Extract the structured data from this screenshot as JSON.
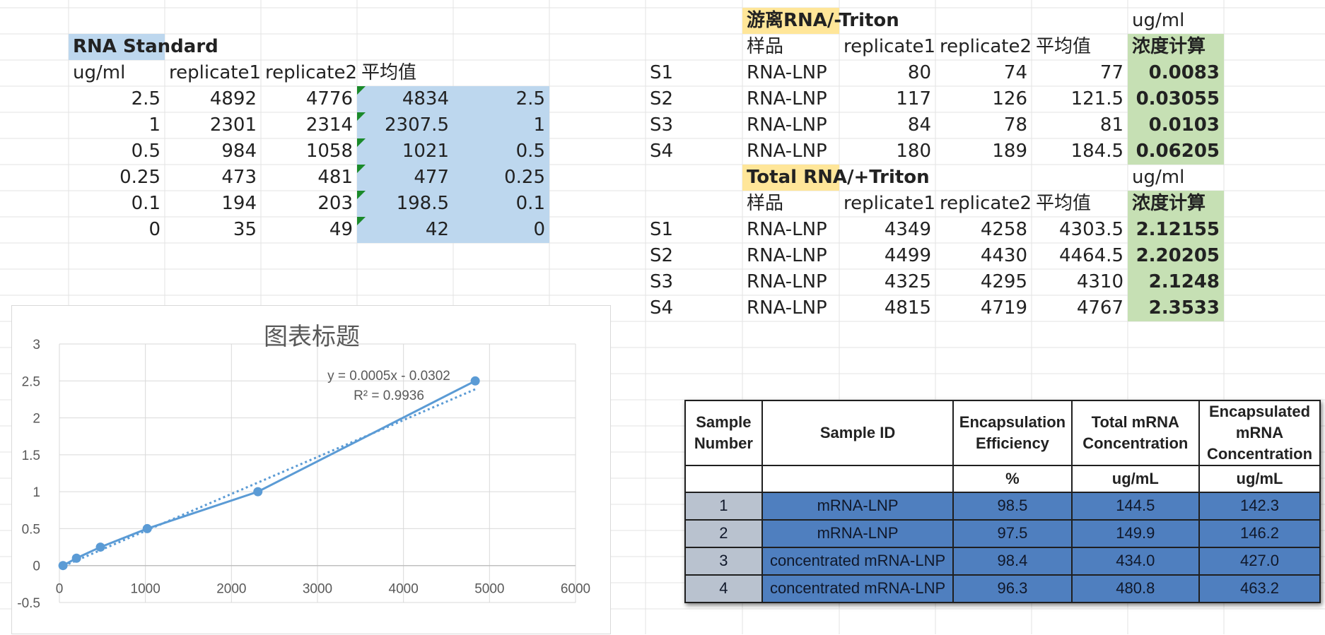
{
  "sheet": {
    "standard": {
      "title": "RNA Standard",
      "headers": [
        "ug/ml",
        "replicate1",
        "replicate2",
        "平均值"
      ],
      "rows": [
        [
          "2.5",
          "4892",
          "4776",
          "4834",
          "2.5"
        ],
        [
          "1",
          "2301",
          "2314",
          "2307.5",
          "1"
        ],
        [
          "0.5",
          "984",
          "1058",
          "1021",
          "0.5"
        ],
        [
          "0.25",
          "473",
          "481",
          "477",
          "0.25"
        ],
        [
          "0.1",
          "194",
          "203",
          "198.5",
          "0.1"
        ],
        [
          "0",
          "35",
          "49",
          "42",
          "0"
        ]
      ]
    },
    "free_rna": {
      "title": "游离RNA/-Triton",
      "unit": "ug/ml",
      "headers": [
        "样品",
        "replicate1",
        "replicate2",
        "平均值",
        "浓度计算"
      ],
      "rows": [
        [
          "S1",
          "RNA-LNP",
          "80",
          "74",
          "77",
          "0.0083"
        ],
        [
          "S2",
          "RNA-LNP",
          "117",
          "126",
          "121.5",
          "0.03055"
        ],
        [
          "S3",
          "RNA-LNP",
          "84",
          "78",
          "81",
          "0.0103"
        ],
        [
          "S4",
          "RNA-LNP",
          "180",
          "189",
          "184.5",
          "0.06205"
        ]
      ]
    },
    "total_rna": {
      "title": "Total RNA/+Triton",
      "unit": "ug/ml",
      "headers": [
        "样品",
        "replicate1",
        "replicate2",
        "平均值",
        "浓度计算"
      ],
      "rows": [
        [
          "S1",
          "RNA-LNP",
          "4349",
          "4258",
          "4303.5",
          "2.12155"
        ],
        [
          "S2",
          "RNA-LNP",
          "4499",
          "4430",
          "4464.5",
          "2.20205"
        ],
        [
          "S3",
          "RNA-LNP",
          "4325",
          "4295",
          "4310",
          "2.1248"
        ],
        [
          "S4",
          "RNA-LNP",
          "4815",
          "4719",
          "4767",
          "2.3533"
        ]
      ]
    }
  },
  "chart_data": {
    "type": "scatter",
    "title": "图表标题",
    "x": [
      4834,
      2307.5,
      1021,
      477,
      198.5,
      42
    ],
    "y": [
      2.5,
      1,
      0.5,
      0.25,
      0.1,
      0
    ],
    "series_color": "#5b9bd5",
    "trendline": {
      "label": "y = 0.0005x - 0.0302",
      "r2": "R² = 0.9936",
      "slope": 0.0005,
      "intercept": -0.0302
    },
    "xlim": [
      0,
      6000
    ],
    "ylim": [
      -0.5,
      3
    ],
    "x_ticks": [
      "0",
      "1000",
      "2000",
      "3000",
      "4000",
      "5000",
      "6000"
    ],
    "y_ticks": [
      "3",
      "2.5",
      "2",
      "1.5",
      "1",
      "0.5",
      "0",
      "-0.5"
    ],
    "grid": true
  },
  "image_table": {
    "headers": [
      "Sample Number",
      "Sample ID",
      "Encapsulation Efficiency",
      "Total mRNA Concentration",
      "Encapsulated mRNA Concentration"
    ],
    "units": [
      "",
      "",
      "%",
      "ug/mL",
      "ug/mL"
    ],
    "rows": [
      [
        "1",
        "mRNA-LNP",
        "98.5",
        "144.5",
        "142.3"
      ],
      [
        "2",
        "mRNA-LNP",
        "97.5",
        "149.9",
        "146.2"
      ],
      [
        "3",
        "concentrated mRNA-LNP",
        "98.4",
        "434.0",
        "427.0"
      ],
      [
        "4",
        "concentrated mRNA-LNP",
        "96.3",
        "480.8",
        "463.2"
      ]
    ]
  },
  "colors": {
    "standard_fill": "#bdd7ee",
    "header_yellow": "#ffe699",
    "result_green": "#c6e0b4",
    "table_blue": "#4f7fbf"
  }
}
